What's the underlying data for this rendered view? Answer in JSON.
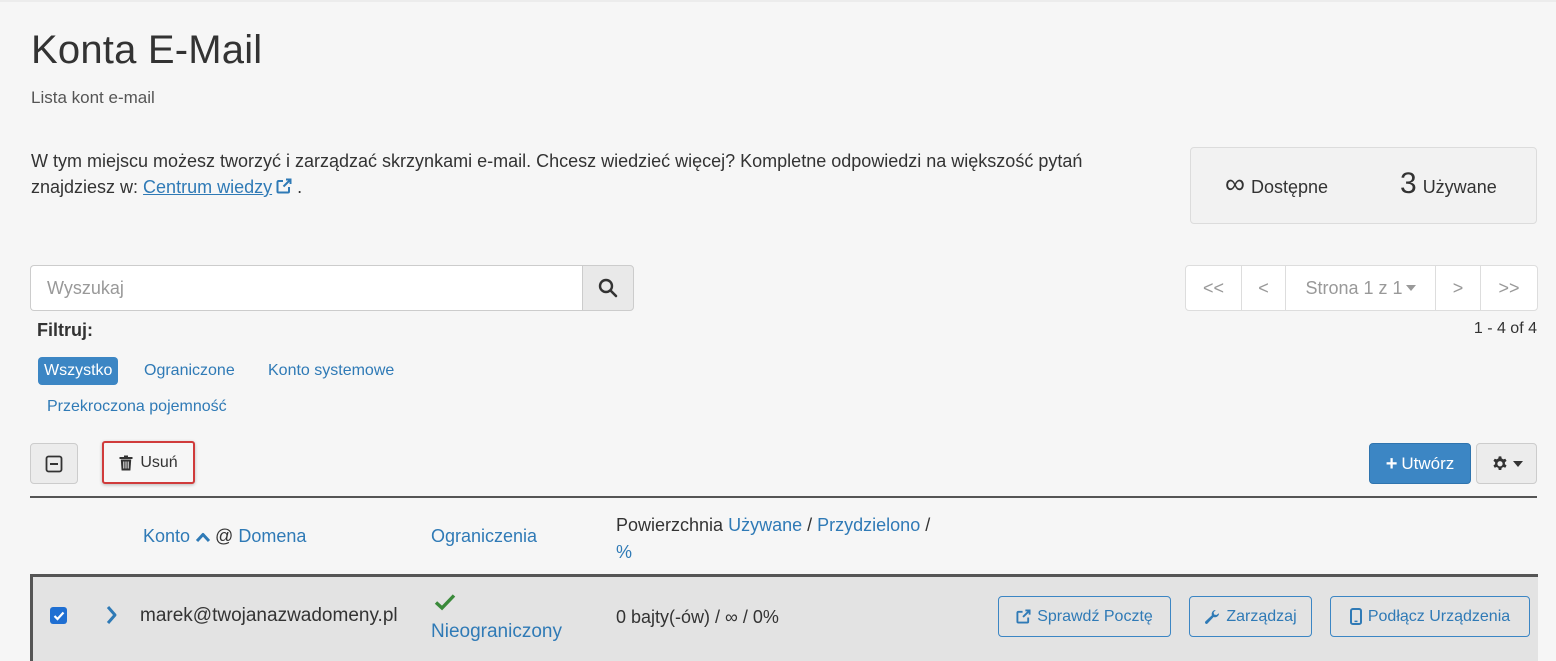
{
  "header": {
    "title": "Konta E-Mail",
    "subtitle": "Lista kont e-mail"
  },
  "intro": {
    "text_line": "W tym miejscu możesz tworzyć i zarządzać skrzynkami e-mail. Chcesz wiedzieć więcej? Kompletne odpowiedzi na większość pytań znajdziesz w: ",
    "link_text": "Centrum wiedzy",
    "suffix": "."
  },
  "stats": {
    "available_value": "∞",
    "available_label": "Dostępne",
    "used_value": "3",
    "used_label": "Używane"
  },
  "search": {
    "placeholder": "Wyszukaj"
  },
  "pagination": {
    "first": "<<",
    "prev": "<",
    "page": "Strona 1 z 1",
    "next": ">",
    "last": ">>",
    "range": "1 - 4 of 4"
  },
  "filter": {
    "label": "Filtruj:",
    "options": [
      "Wszystko",
      "Ograniczone",
      "Konto systemowe",
      "Przekroczona pojemność"
    ],
    "active": "Wszystko"
  },
  "toolbar": {
    "delete_label": "Usuń",
    "create_label": "Utwórz"
  },
  "table": {
    "col_account": "Konto",
    "col_at": "@",
    "col_domain": "Domena",
    "col_restrictions": "Ograniczenia",
    "col_space_prefix": "Powierzchnia",
    "col_space_used": "Używane",
    "col_space_sep1": "/",
    "col_space_allocated": "Przydzielono",
    "col_space_sep2": "/",
    "col_space_percent": "%",
    "rows": [
      {
        "email": "marek@twojanazwadomeny.pl",
        "restriction": "Nieograniczony",
        "usage": "0 bajty(-ów) / ∞ / 0%",
        "checked": true,
        "actions": [
          "Sprawdź Pocztę",
          "Zarządzaj",
          "Podłącz Urządzenia"
        ]
      }
    ]
  },
  "colors": {
    "accent": "#3c86c4",
    "link": "#2f7ab6",
    "success": "#3a8a3a",
    "highlight_border": "#d03b3b"
  }
}
